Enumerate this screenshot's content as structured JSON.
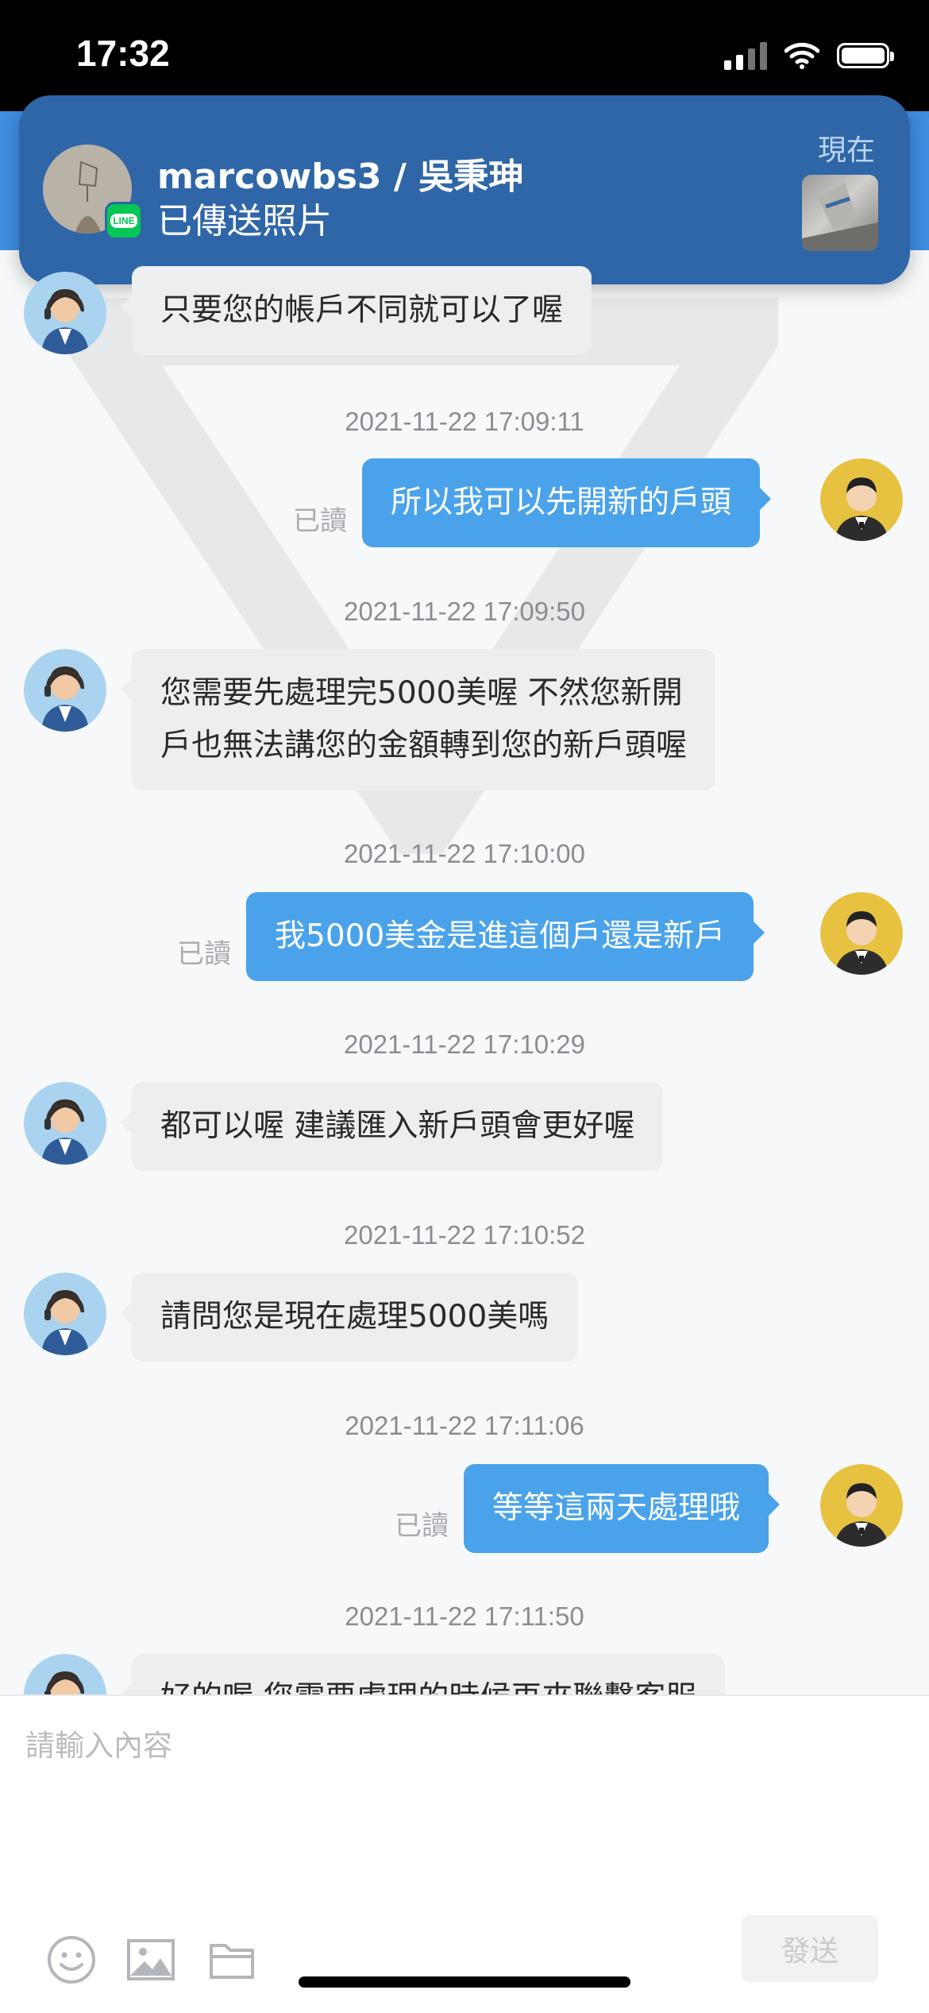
{
  "status_bar": {
    "time": "17:32"
  },
  "notification": {
    "title": "marcowbs3 / 吳秉珅",
    "body": "已傳送照片",
    "time": "現在",
    "app_badge": "LINE"
  },
  "messages": [
    {
      "side": "in",
      "text": "只要您的帳戶不同就可以了喔"
    },
    {
      "timestamp": "2021-11-22 17:09:11",
      "side": "out",
      "status": "已讀",
      "text": "所以我可以先開新的戶頭"
    },
    {
      "timestamp": "2021-11-22 17:09:50",
      "side": "in",
      "lines": [
        "您需要先處理完5000美喔 不然您新開",
        "戶也無法講您的金額轉到您的新戶頭喔"
      ]
    },
    {
      "timestamp": "2021-11-22 17:10:00",
      "side": "out",
      "status": "已讀",
      "text": "我5000美金是進這個戶還是新戶"
    },
    {
      "timestamp": "2021-11-22 17:10:29",
      "side": "in",
      "text": "都可以喔 建議匯入新戶頭會更好喔"
    },
    {
      "timestamp": "2021-11-22 17:10:52",
      "side": "in",
      "text": "請問您是現在處理5000美嗎"
    },
    {
      "timestamp": "2021-11-22 17:11:06",
      "side": "out",
      "status": "已讀",
      "text": "等等這兩天處理哦"
    },
    {
      "timestamp": "2021-11-22 17:11:50",
      "side": "in",
      "text": "好的喔 您需要處理的時候再來聯繫客服"
    }
  ],
  "composer": {
    "placeholder": "請輸入內容",
    "send_label": "發送"
  },
  "colors": {
    "header": "#3f8de0",
    "banner": "#2f66a7",
    "outgoing_bubble": "#4aa3ea",
    "incoming_bubble": "#eceef0"
  }
}
